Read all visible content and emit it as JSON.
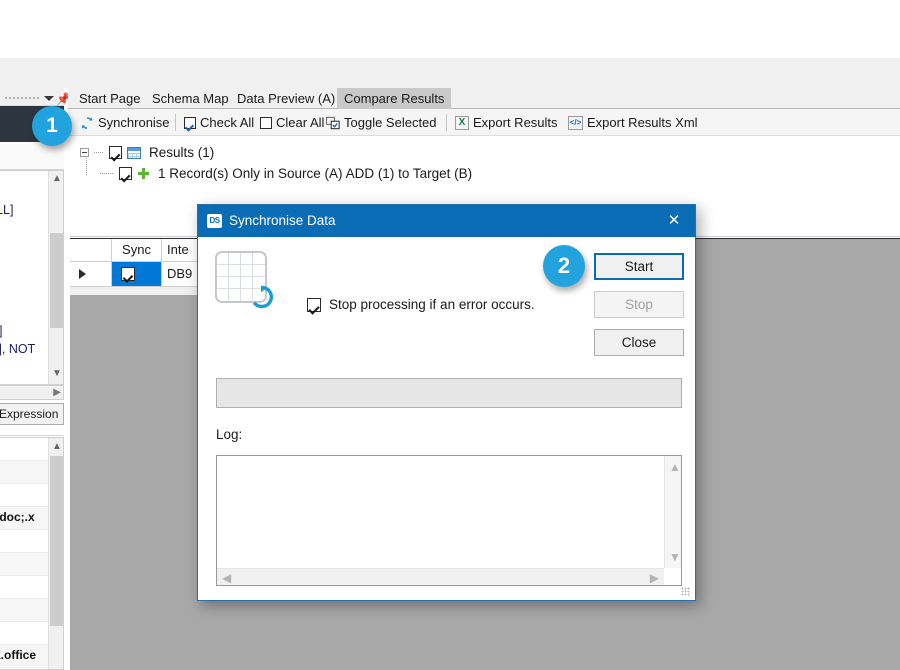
{
  "tabs": [
    {
      "label": "Start Page",
      "active": false
    },
    {
      "label": "Schema Map",
      "active": false
    },
    {
      "label": "Data Preview (A)",
      "active": false
    },
    {
      "label": "Compare Results",
      "active": true
    }
  ],
  "toolbar": {
    "synchronise": "Synchronise",
    "check_all": "Check All",
    "clear_all": "Clear All",
    "toggle_selected": "Toggle Selected",
    "export_results": "Export Results",
    "export_results_xml": "Export Results Xml",
    "xls_icon_glyph": "X",
    "xml_icon_glyph": "</>"
  },
  "tree": {
    "root_label": "Results (1)",
    "child_label": "1 Record(s) Only in Source (A) ADD (1) to Target (B)"
  },
  "results_grid": {
    "columns": [
      "",
      "Sync",
      "Inte"
    ],
    "row_value": "DB9"
  },
  "left_panel": {
    "expression_button": "Expression",
    "list_fragments": [
      "NULL]",
      "]",
      "L]",
      "g[], NOT"
    ],
    "grid_fragments": [
      ";.doc;.x",
      "k.office"
    ]
  },
  "dialog": {
    "title": "Synchronise Data",
    "icon_text": "DS",
    "close_glyph": "✕",
    "checkbox_label": "Stop processing if an error occurs.",
    "checkbox_checked": true,
    "buttons": [
      {
        "label": "Start",
        "state": "focused"
      },
      {
        "label": "Stop",
        "state": "disabled"
      },
      {
        "label": "Close",
        "state": "normal"
      }
    ],
    "log_label": "Log:",
    "log_text": "",
    "progress_value": 0
  },
  "callouts": [
    {
      "number": "1"
    },
    {
      "number": "2"
    }
  ],
  "colors": {
    "accent_blue": "#0a6cb5",
    "callout_blue": "#22a3dd",
    "selection_blue": "#0078d7",
    "plus_green": "#5cb531",
    "canvas_gray": "#a8a8a8"
  }
}
